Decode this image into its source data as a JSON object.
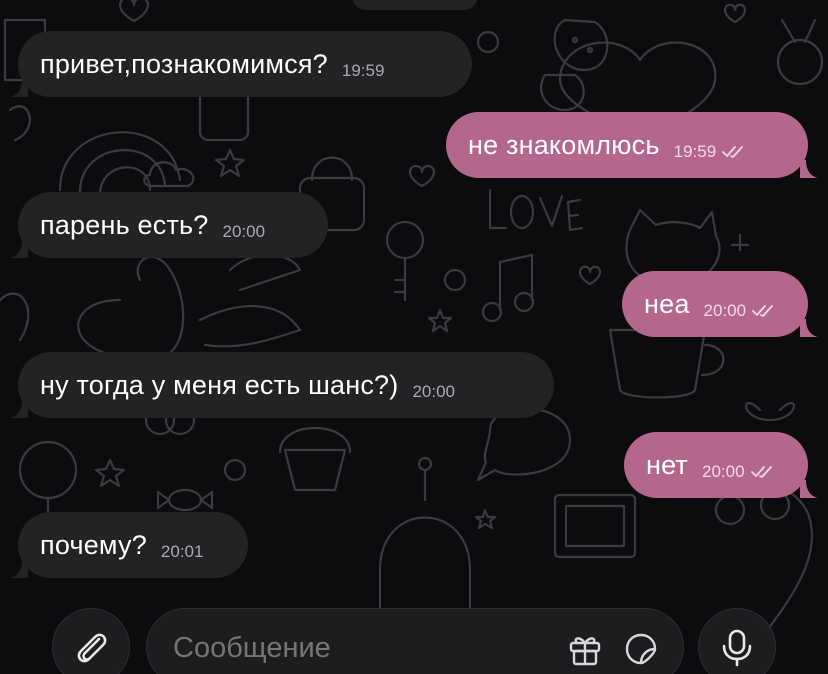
{
  "composer": {
    "placeholder": "Сообщение",
    "attach_icon": "paperclip-icon",
    "gift_icon": "gift-icon",
    "sticker_icon": "sticker-icon",
    "mic_icon": "microphone-icon"
  },
  "messages": [
    {
      "direction": "incoming",
      "text": "привет,познакомимся?",
      "time": "19:59"
    },
    {
      "direction": "outgoing",
      "text": "не знакомлюсь",
      "time": "19:59",
      "status": "read"
    },
    {
      "direction": "incoming",
      "text": "парень есть?",
      "time": "20:00"
    },
    {
      "direction": "outgoing",
      "text": "неа",
      "time": "20:00",
      "status": "read"
    },
    {
      "direction": "incoming",
      "text": "ну тогда у меня есть шанс?)",
      "time": "20:00"
    },
    {
      "direction": "outgoing",
      "text": "нет",
      "time": "20:00",
      "status": "read"
    },
    {
      "direction": "incoming",
      "text": "почему?",
      "time": "20:01"
    }
  ],
  "colors": {
    "background": "#0c0c0f",
    "incoming_bubble": "#232326",
    "outgoing_bubble": "#b4668f",
    "wallpaper_lines": "#3a3a3f"
  }
}
